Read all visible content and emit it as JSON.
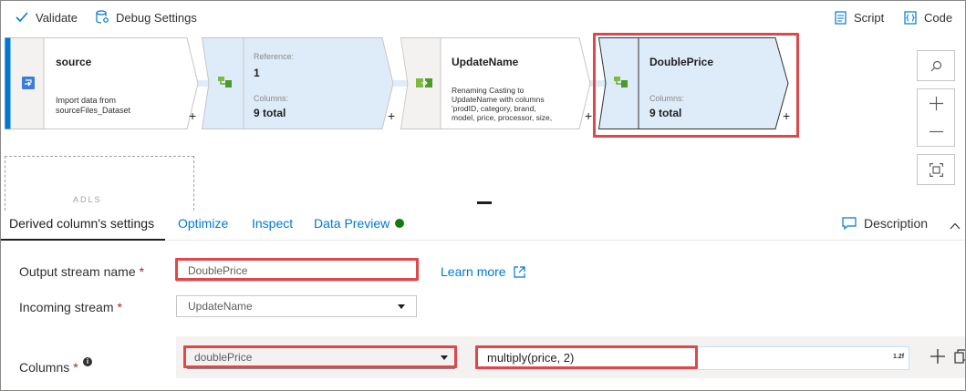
{
  "toolbar": {
    "validate_label": "Validate",
    "debug_label": "Debug Settings",
    "script_label": "Script",
    "code_label": "Code"
  },
  "flow": {
    "source": {
      "title": "source",
      "desc_line1": "Import data from",
      "desc_line2": "sourceFiles_Dataset"
    },
    "reference": {
      "ref_label": "Reference:",
      "ref_value": "1",
      "columns_label": "Columns:",
      "columns_value": "9 total"
    },
    "update_name": {
      "title": "UpdateName",
      "desc_line1": "Renaming Casting to",
      "desc_line2": "UpdateName with columns",
      "desc_line3": "'prodID, category, brand,",
      "desc_line4": "model, price, processor, size,"
    },
    "double_price": {
      "title": "DoublePrice",
      "columns_label": "Columns:",
      "columns_value": "9 total"
    },
    "plus": "+",
    "partial_label": "ADLS"
  },
  "tabs": {
    "settings": "Derived column's settings",
    "optimize": "Optimize",
    "inspect": "Inspect",
    "data_preview": "Data Preview",
    "description": "Description"
  },
  "form": {
    "output_stream_label": "Output stream name",
    "output_stream_value": "DoublePrice",
    "required_mark": "*",
    "learn_more": "Learn more",
    "incoming_stream_label": "Incoming stream",
    "incoming_stream_value": "UpdateName",
    "columns_label": "Columns",
    "info_glyph": "i",
    "column_name": "doublePrice",
    "expression": "multiply(price, 2)",
    "expression_type": "1.2f"
  },
  "colors": {
    "accent": "#0078d4",
    "highlight": "#e0474b",
    "node_selected_fill": "#deecf9",
    "status_green": "#107c10"
  }
}
